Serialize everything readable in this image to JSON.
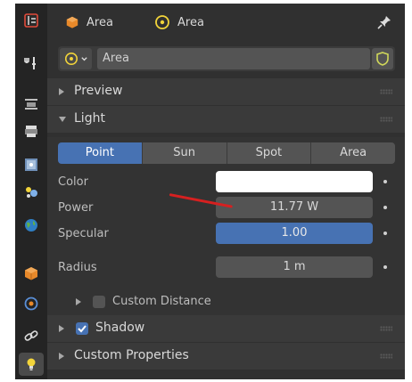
{
  "header": {
    "object_label": "Area",
    "data_label": "Area"
  },
  "datablock": {
    "name": "Area"
  },
  "sections": {
    "preview": "Preview",
    "light": "Light",
    "custom_distance": "Custom Distance",
    "shadow": "Shadow",
    "custom_properties": "Custom Properties"
  },
  "light_types": [
    "Point",
    "Sun",
    "Spot",
    "Area"
  ],
  "active_light_type": "Point",
  "properties": {
    "color_label": "Color",
    "color_value": "#ffffff",
    "power_label": "Power",
    "power_value": "11.77 W",
    "specular_label": "Specular",
    "specular_value": "1.00",
    "specular_fraction": 1.0,
    "radius_label": "Radius",
    "radius_value": "1 m"
  },
  "checkboxes": {
    "custom_distance": false,
    "shadow": true
  },
  "colors": {
    "accent": "#4772b3",
    "annotation": "#d62020",
    "object_orange": "#e8892a",
    "light_yellow": "#f2d43a"
  },
  "icons": {
    "tabs": [
      "tool-icon",
      "render-icon",
      "output-icon",
      "view-layer-icon",
      "scene-icon",
      "world-icon",
      "object-icon",
      "physics-icon",
      "constraints-icon",
      "object-data-light-icon"
    ],
    "header": [
      "object-cube-icon",
      "light-data-icon",
      "pin-icon"
    ]
  }
}
